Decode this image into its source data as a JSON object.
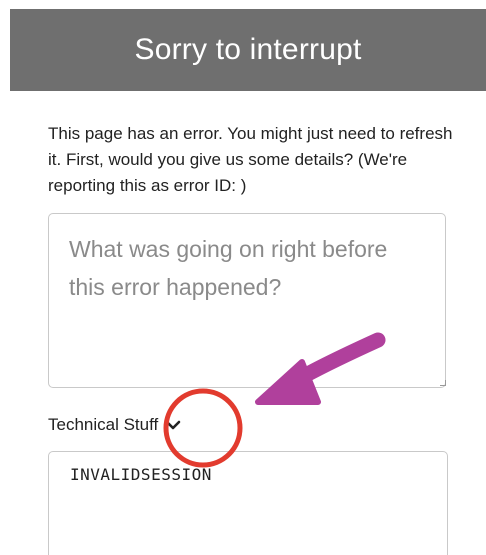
{
  "dialog": {
    "title": "Sorry to interrupt",
    "message": "This page has an error. You might just need to refresh it. First, would you give us some details? (We're reporting this as error ID: )",
    "description_placeholder": "What was going on right before this error happened?",
    "technical_label": "Technical Stuff",
    "technical_content": "INVALIDSESSION"
  },
  "annotation": {
    "circle_color": "#e23b2e",
    "arrow_color": "#b0409c"
  },
  "icons": {
    "technical_toggle": "chevron-down-icon"
  }
}
